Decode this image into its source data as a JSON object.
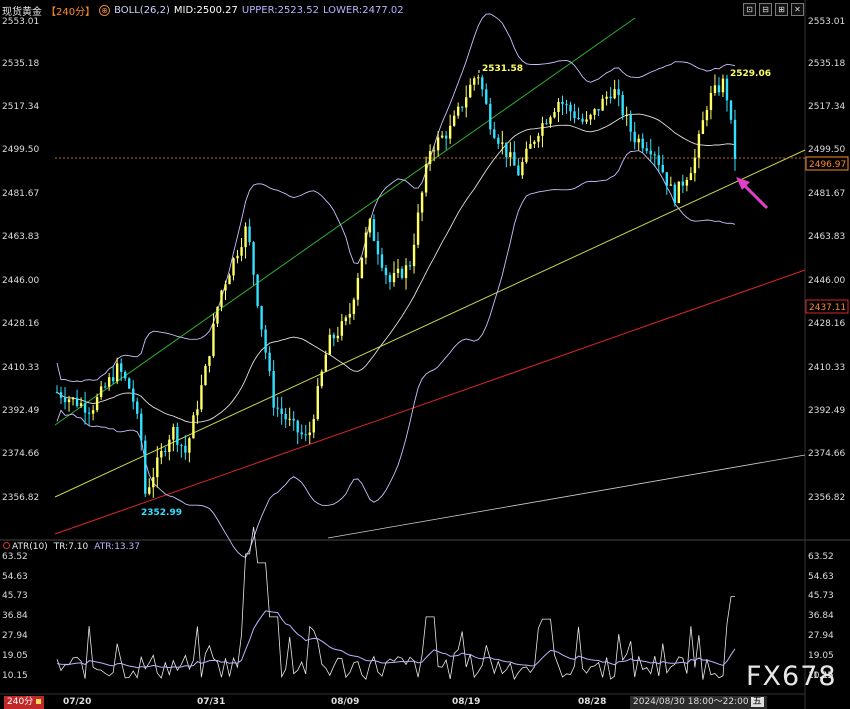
{
  "header": {
    "symbol": "现货黄金",
    "timeframe": "【240分】",
    "indicator": "BOLL(26,2)",
    "mid": "MID:2500.27",
    "upper": "UPPER:2523.52",
    "lower": "LOWER:2477.02"
  },
  "window_buttons": [
    "⊡",
    "⊟",
    "⊞",
    "✕"
  ],
  "price_axis": {
    "labels": [
      "2553.01",
      "2535.18",
      "2517.34",
      "2499.50",
      "2481.67",
      "2463.83",
      "2446.00",
      "2428.16",
      "2410.33",
      "2392.49",
      "2374.66",
      "2356.82"
    ],
    "current_price": "2496.97",
    "red_line_price": "2437.11"
  },
  "annotations": {
    "high_left": "2531.58",
    "high_right": "2529.06",
    "low": "2352.99"
  },
  "atr_panel": {
    "title": "ATR(10)",
    "tr": "TR:7.10",
    "atr": "ATR:13.37",
    "labels": [
      "63.52",
      "54.63",
      "45.73",
      "36.84",
      "27.94",
      "19.05",
      "10.15"
    ],
    "watermark_overlap_label": "1.25"
  },
  "x_axis": {
    "labels": [
      "07/20",
      "07/31",
      "08/09",
      "08/19",
      "08/28"
    ]
  },
  "footer": {
    "badge": "240分",
    "datetime": "2024/08/30 18:00～22:00",
    "weekday": "五"
  },
  "watermark": "FX678",
  "colors": {
    "bull": "#ffff66",
    "bear": "#33e0ff",
    "upper_band": "#c8c0ff",
    "mid_band": "#e0e0e0",
    "green_channel": "#2fae2f",
    "yellow_channel": "#c9d24a",
    "red_channel": "#d8262b",
    "arrow": "#e040c8",
    "current_price_line": "#ff8a2a"
  },
  "icons": [
    "info-circle-icon",
    "pink-arrow-icon"
  ]
}
